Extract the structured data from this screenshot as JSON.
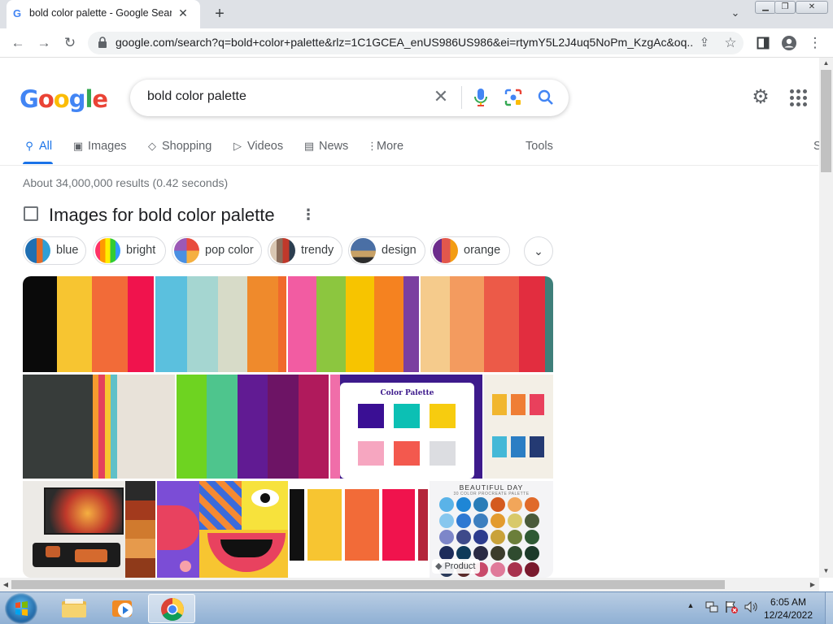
{
  "browser": {
    "tab_title": "bold color palette - Google Search",
    "url": "google.com/search?q=bold+color+palette&rlz=1C1GCEA_enUS986US986&ei=rtymY5L2J4uq5NoPm_KzgAc&oq..."
  },
  "google": {
    "logo": [
      "G",
      "o",
      "o",
      "g",
      "l",
      "e"
    ],
    "logo_colors": [
      "#4285f4",
      "#ea4335",
      "#fbbc05",
      "#4285f4",
      "#34a853",
      "#ea4335"
    ],
    "query": "bold color palette",
    "tabs": [
      "All",
      "Images",
      "Shopping",
      "Videos",
      "News",
      "More"
    ],
    "tools": "Tools",
    "edge_text": "S",
    "stats": "About 34,000,000 results (0.42 seconds)",
    "images_heading": "Images for bold color palette",
    "chips": [
      {
        "label": "blue",
        "colors": [
          "#1f6fb2",
          "#e06a2a",
          "#2e9fd6"
        ]
      },
      {
        "label": "bright",
        "colors": [
          "#ffcc00",
          "#33cc33",
          "#ff3366"
        ]
      },
      {
        "label": "pop color",
        "colors": [
          "#e84c3d",
          "#f5b041",
          "#4a90e2"
        ]
      },
      {
        "label": "trendy",
        "colors": [
          "#8a6d5b",
          "#c0392b",
          "#2c3e50"
        ]
      },
      {
        "label": "design",
        "colors": [
          "#4a6fa5",
          "#c8a165",
          "#2d2d2d"
        ]
      },
      {
        "label": "orange",
        "colors": [
          "#e2574c",
          "#6c2c8c",
          "#f39c12"
        ]
      }
    ],
    "product_badge": "Product",
    "palette_title": "Color Palette",
    "beautiful_day": "BEAUTIFUL DAY",
    "procreate": "30 COLOR PROCREATE PALETTE"
  },
  "taskbar": {
    "time": "6:05 AM",
    "date": "12/24/2022"
  }
}
